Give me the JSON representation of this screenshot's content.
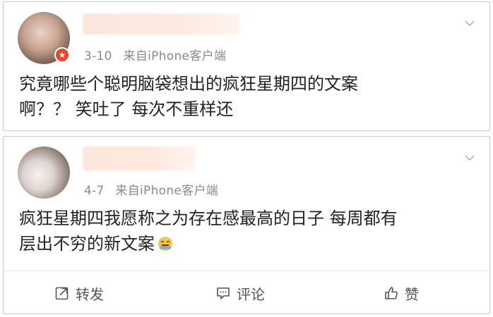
{
  "posts": [
    {
      "date": "3-10",
      "source": "来自iPhone客户端",
      "text": "究竟哪些个聪明脑袋想出的疯狂星期四的文案\n啊？？ 笑吐了 每次不重样还"
    },
    {
      "date": "4-7",
      "source": "来自iPhone客户端",
      "text": "疯狂星期四我愿称之为存在感最高的日子 每周都有\n层出不穷的新文案"
    }
  ],
  "actions": {
    "repost": "转发",
    "comment": "评论",
    "like": "赞"
  },
  "icons": {
    "badge": "verified-badge-icon",
    "menu": "chevron-down-icon",
    "emoji": "laughing-emoji-icon",
    "repost": "share-icon",
    "comment": "comment-icon",
    "like": "thumbs-up-icon"
  },
  "colors": {
    "accent": "#e8452b",
    "meta": "#8a8a8a",
    "border": "#c9c9c9"
  }
}
